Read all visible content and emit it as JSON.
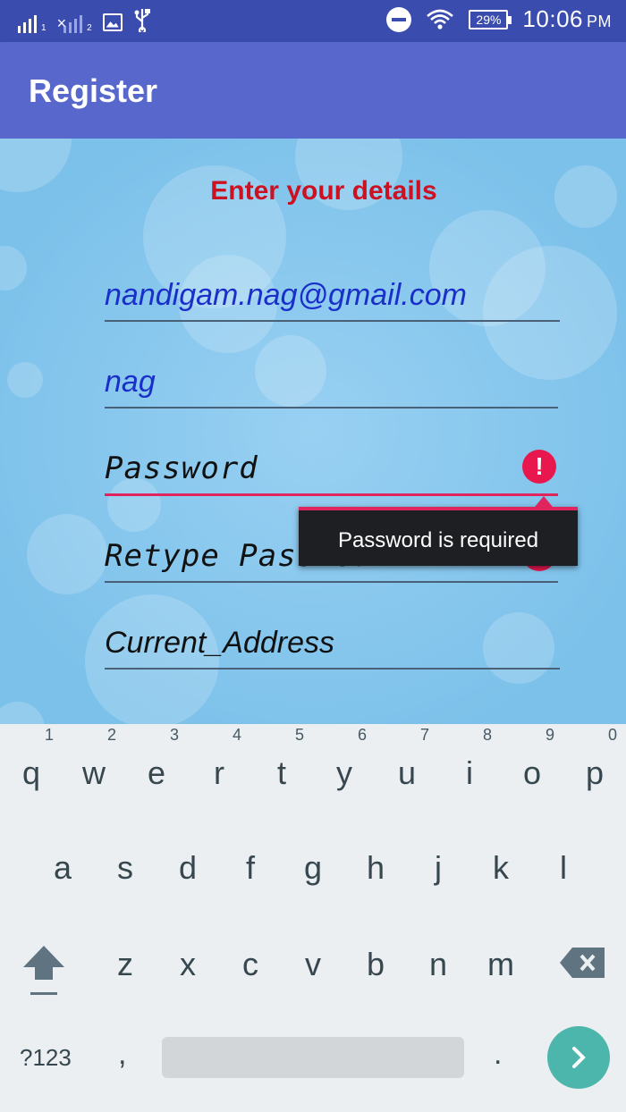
{
  "status_bar": {
    "sim1_label": "1",
    "sim2_label": "2",
    "sim2_x": "×",
    "battery": "29%",
    "time": "10:06",
    "ampm": "PM",
    "icons": [
      "signal-sim1-icon",
      "signal-sim2-icon",
      "gallery-notification-icon",
      "usb-icon",
      "do-not-disturb-icon",
      "wifi-icon",
      "battery-icon"
    ]
  },
  "app_bar": {
    "title": "Register"
  },
  "form": {
    "heading": "Enter your details",
    "email_value": "nandigam.nag@gmail.com",
    "name_value": "nag",
    "password_placeholder": "Password",
    "retype_password_placeholder": "Retype Password",
    "address_placeholder": "Current_Address",
    "error_tooltip": "Password is required",
    "error_icon": "!"
  },
  "keyboard": {
    "row1": [
      {
        "key": "q",
        "hint": "1"
      },
      {
        "key": "w",
        "hint": "2"
      },
      {
        "key": "e",
        "hint": "3"
      },
      {
        "key": "r",
        "hint": "4"
      },
      {
        "key": "t",
        "hint": "5"
      },
      {
        "key": "y",
        "hint": "6"
      },
      {
        "key": "u",
        "hint": "7"
      },
      {
        "key": "i",
        "hint": "8"
      },
      {
        "key": "o",
        "hint": "9"
      },
      {
        "key": "p",
        "hint": "0"
      }
    ],
    "row2": [
      "a",
      "s",
      "d",
      "f",
      "g",
      "h",
      "j",
      "k",
      "l"
    ],
    "row3": [
      "z",
      "x",
      "c",
      "v",
      "b",
      "n",
      "m"
    ],
    "symbols_label": "?123",
    "comma_label": ",",
    "period_label": ".",
    "colors": {
      "enter_key": "#4db6ac",
      "error": "#e0245e",
      "heading": "#cc1122",
      "app_bar": "#5867cc",
      "status_bar": "#3b4caf"
    }
  }
}
